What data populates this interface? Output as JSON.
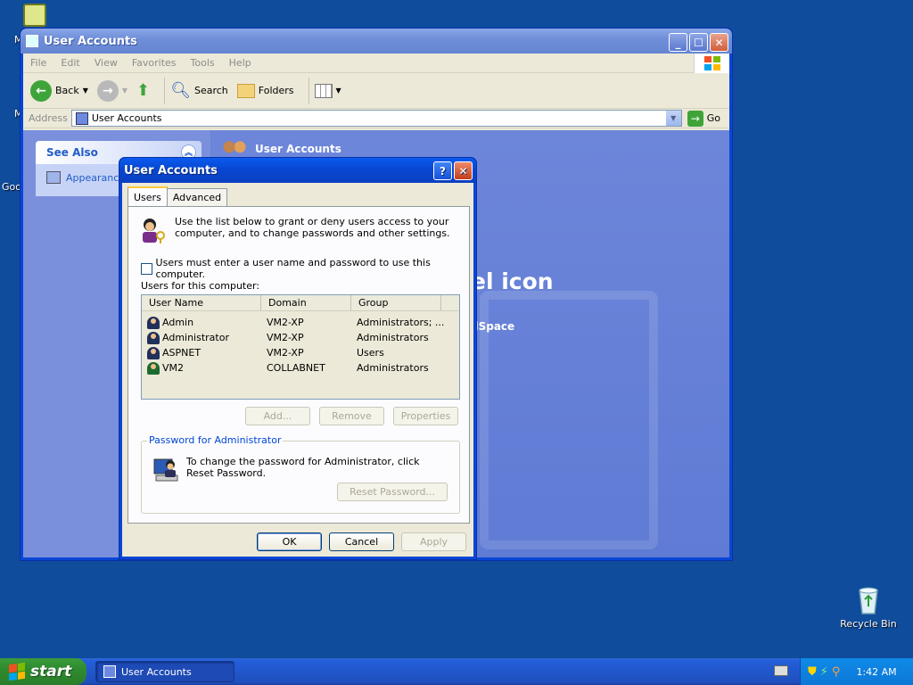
{
  "desktop": {
    "recycle_bin_label": "Recycle Bin",
    "fragments": [
      "M",
      "M",
      "Goo"
    ]
  },
  "explorer": {
    "title": "User Accounts",
    "menu": [
      "File",
      "Edit",
      "View",
      "Favorites",
      "Tools",
      "Help"
    ],
    "toolbar": {
      "back_label": "Back",
      "search_label": "Search",
      "folders_label": "Folders"
    },
    "address": {
      "label": "Address",
      "value": "User Accounts",
      "go_label": "Go"
    },
    "see_also": {
      "title": "See Also",
      "item": "Appearance"
    },
    "right": {
      "header": "User Accounts",
      "big_text": "el icon",
      "small_text": "dSpace"
    }
  },
  "dialog": {
    "title": "User Accounts",
    "tabs": [
      {
        "label": "Users",
        "active": true
      },
      {
        "label": "Advanced",
        "active": false
      }
    ],
    "intro": "Use the list below to grant or deny users access to your computer, and to change passwords and other settings.",
    "checkbox_label": "Users must enter a user name and password to use this computer.",
    "users_label": "Users for this computer:",
    "columns": [
      "User Name",
      "Domain",
      "Group"
    ],
    "users": [
      {
        "name": "Admin",
        "domain": "VM2-XP",
        "group": "Administrators; ..."
      },
      {
        "name": "Administrator",
        "domain": "VM2-XP",
        "group": "Administrators"
      },
      {
        "name": "ASPNET",
        "domain": "VM2-XP",
        "group": "Users"
      },
      {
        "name": "VM2",
        "domain": "COLLABNET",
        "group": "Administrators"
      }
    ],
    "list_buttons": {
      "add": "Add...",
      "remove": "Remove",
      "properties": "Properties"
    },
    "password_group": {
      "legend": "Password for Administrator",
      "text": "To change the password for Administrator, click Reset Password.",
      "reset_label": "Reset Password..."
    },
    "footer": {
      "ok": "OK",
      "cancel": "Cancel",
      "apply": "Apply"
    }
  },
  "taskbar": {
    "start_label": "start",
    "task_label": "User Accounts",
    "clock": "1:42 AM"
  }
}
